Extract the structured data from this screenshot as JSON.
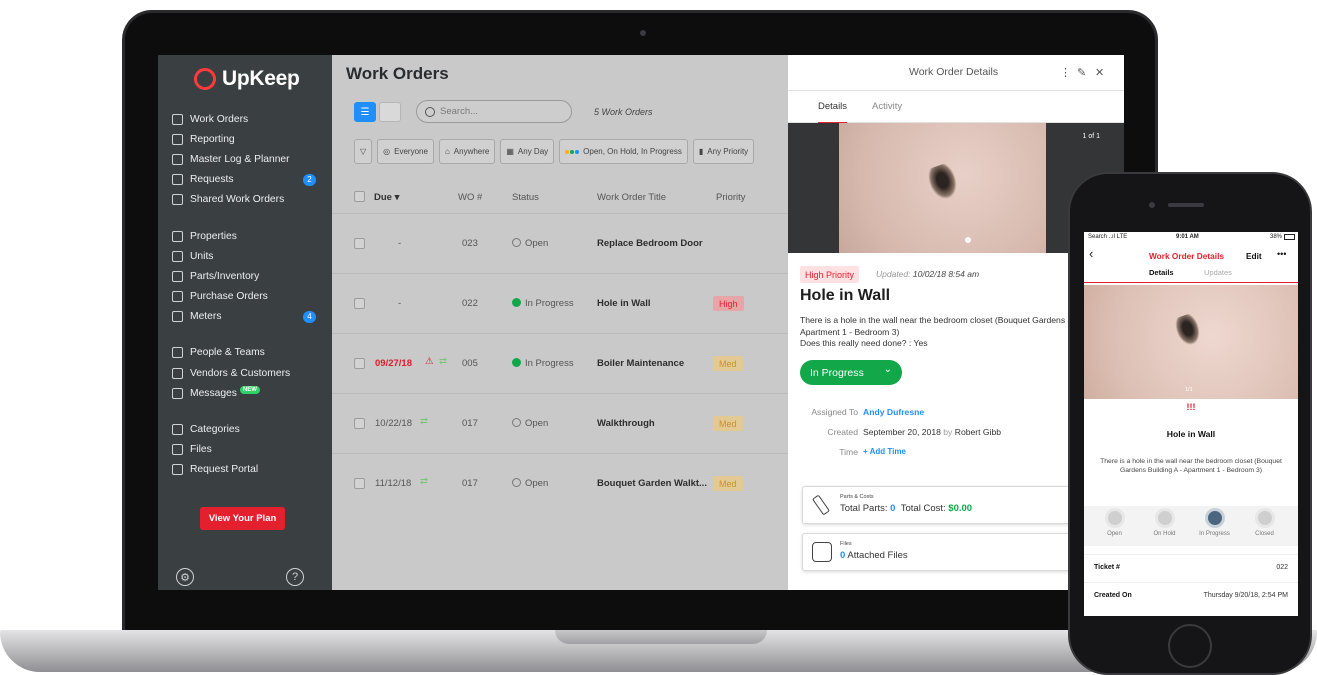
{
  "brand": {
    "name": "UpKeep",
    "accent": "#e5202e",
    "blue": "#1f8fff",
    "green": "#12a84a"
  },
  "sidebar": {
    "items": [
      {
        "label": "Work Orders",
        "icon": "clipboard-icon"
      },
      {
        "label": "Reporting",
        "icon": "chart-icon"
      },
      {
        "label": "Master Log & Planner",
        "icon": "calendar-icon"
      },
      {
        "label": "Requests",
        "icon": "inbox-icon",
        "badge": "2"
      },
      {
        "label": "Shared Work Orders",
        "icon": "share-icon"
      },
      {
        "label": "Properties",
        "icon": "location-icon"
      },
      {
        "label": "Units",
        "icon": "cube-icon"
      },
      {
        "label": "Parts/Inventory",
        "icon": "wrench-icon"
      },
      {
        "label": "Purchase Orders",
        "icon": "document-icon"
      },
      {
        "label": "Meters",
        "icon": "gauge-icon",
        "badge": "4"
      },
      {
        "label": "People & Teams",
        "icon": "people-icon"
      },
      {
        "label": "Vendors & Customers",
        "icon": "vendors-icon"
      },
      {
        "label": "Messages",
        "icon": "chat-icon",
        "tag": "NEW"
      },
      {
        "label": "Categories",
        "icon": "bookmark-icon"
      },
      {
        "label": "Files",
        "icon": "file-icon"
      },
      {
        "label": "Request Portal",
        "icon": "portal-icon"
      }
    ],
    "plan_button": "View Your Plan",
    "settings_glyph": "⚙",
    "help_glyph": "?"
  },
  "main": {
    "title": "Work Orders",
    "search_placeholder": "Search...",
    "count": "5 Work Orders",
    "filters": [
      "Everyone",
      "Anywhere",
      "Any Day",
      "Open, On Hold, In Progress",
      "Any Priority"
    ],
    "columns": {
      "due": "Due",
      "sort": "▾",
      "wo": "WO #",
      "status": "Status",
      "title": "Work Order Title",
      "priority": "Priority"
    },
    "rows": [
      {
        "due": "-",
        "wo": "023",
        "status": "Open",
        "title": "Replace Bedroom Door",
        "priority": ""
      },
      {
        "due": "-",
        "wo": "022",
        "status": "In Progress",
        "title": "Hole in Wall",
        "priority": "High"
      },
      {
        "due": "09/27/18",
        "wo": "005",
        "status": "In Progress",
        "title": "Boiler Maintenance",
        "priority": "Med"
      },
      {
        "due": "10/22/18",
        "wo": "017",
        "status": "Open",
        "title": "Walkthrough",
        "priority": "Med"
      },
      {
        "due": "11/12/18",
        "wo": "017",
        "status": "Open",
        "title": "Bouquet Garden Walkt...",
        "priority": "Med"
      }
    ]
  },
  "detail": {
    "header": "Work Order Details",
    "tabs": [
      "Details",
      "Activity"
    ],
    "photo_count": "1 of 1",
    "priority": "High Priority",
    "updated_label": "Updated:",
    "updated_value": "10/02/18 8:54 am",
    "title": "Hole in Wall",
    "description": "There is a hole in the wall near the bedroom closet (Bouquet Gardens Building A - Apartment 1 - Bedroom 3)",
    "question": "Does this really need done? : Yes",
    "status": "In Progress",
    "assigned_label": "Assigned To",
    "assigned_value": "Andy Dufresne",
    "created_label": "Created",
    "created_value": "September 20, 2018",
    "created_by_word": "by",
    "created_by": "Robert Gibb",
    "time_label": "Time",
    "time_value": "+ Add Time",
    "parts_small": "Parts & Costs",
    "parts_label": "Total Parts:",
    "parts_value": "0",
    "cost_label": "Total Cost:",
    "cost_value": "$0.00",
    "files_small": "Files",
    "files_value": "0",
    "files_label": "Attached Files"
  },
  "phone": {
    "status_left": "Search ..ıl LTE",
    "status_time": "9:01 AM",
    "status_right": "38%",
    "nav_title": "Work Order Details",
    "edit": "Edit",
    "more": "•••",
    "tabs": [
      "Details",
      "Updates"
    ],
    "photo_count": "1/1",
    "priority_marks": "!!!",
    "title": "Hole in Wall",
    "description": "There is a hole in the wall near the bedroom closet (Bouquet Gardens Building A - Apartment 1 - Bedroom 3)",
    "states": [
      "Open",
      "On Hold",
      "In Progress",
      "Closed"
    ],
    "ticket_label": "Ticket #",
    "ticket_value": "022",
    "created_label": "Created On",
    "created_value": "Thursday 9/20/18, 2:54 PM"
  }
}
